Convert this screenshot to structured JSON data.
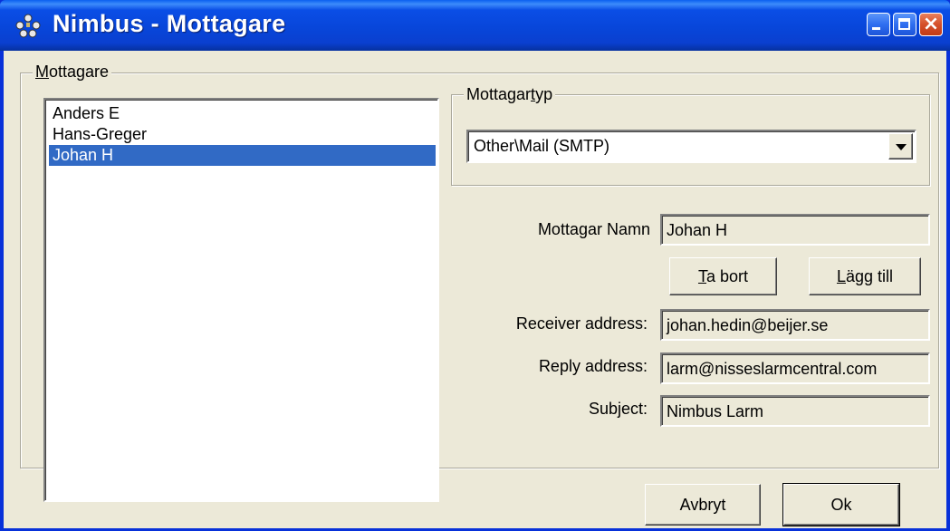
{
  "window": {
    "title": "Nimbus - Mottagare",
    "icons": {
      "app": "network-people-icon",
      "minimize": "minimize-icon",
      "maximize": "maximize-icon",
      "close": "close-icon"
    }
  },
  "recipients": {
    "group_label_accel": "M",
    "group_label_rest": "ottagare",
    "items": [
      {
        "label": "Anders E",
        "selected": false
      },
      {
        "label": "Hans-Greger",
        "selected": false
      },
      {
        "label": "Johan H",
        "selected": true
      }
    ],
    "selection_color": "#316ac5"
  },
  "recipient_type": {
    "group_label_pre": "Mottagar",
    "group_label_accel": "t",
    "group_label_post": "yp",
    "selected": "Other\\Mail (SMTP)"
  },
  "form": {
    "name_label": "Mottagar Namn",
    "name_value": "Johan H",
    "remove_accel": "T",
    "remove_rest": "a bort",
    "add_accel": "L",
    "add_rest": "ägg till",
    "receiver_label": "Receiver address:",
    "receiver_value": "johan.hedin@beijer.se",
    "reply_label": "Reply address:",
    "reply_value": "larm@nisseslarmcentral.com",
    "subject_label": "Subject:",
    "subject_value": "Nimbus Larm"
  },
  "footer": {
    "cancel_label": "Avbryt",
    "ok_label": "Ok"
  }
}
